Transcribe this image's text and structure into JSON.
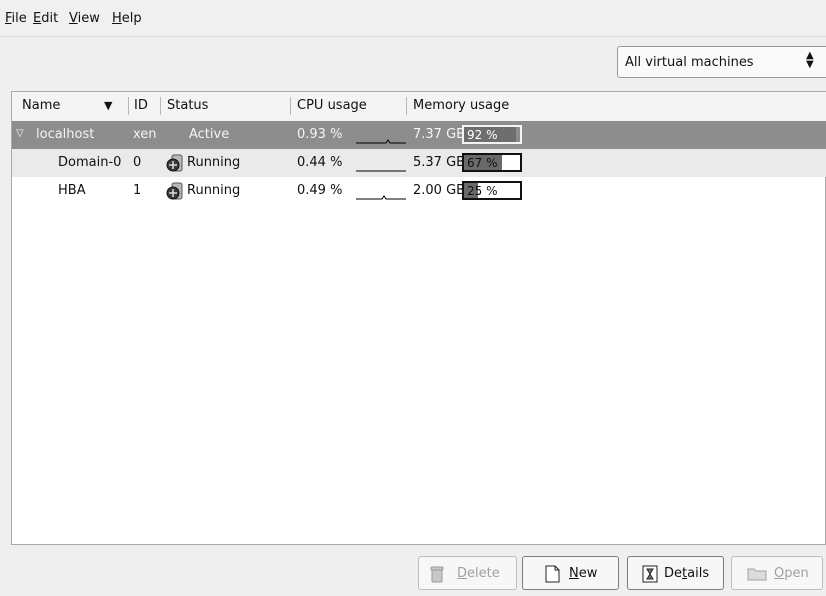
{
  "menu": {
    "file": {
      "first": "F",
      "rest": "ile"
    },
    "edit": {
      "first": "E",
      "rest": "dit"
    },
    "view": {
      "first": "V",
      "rest": "iew"
    },
    "help": {
      "first": "H",
      "rest": "elp"
    }
  },
  "filter": {
    "selected": "All virtual machines"
  },
  "columns": {
    "name": "Name",
    "id": "ID",
    "status": "Status",
    "cpu": "CPU usage",
    "memory": "Memory usage"
  },
  "rows": [
    {
      "name": "localhost",
      "id": "xen",
      "status": "Active",
      "cpu": "0.93 %",
      "mem": "7.37 GB",
      "mem_pct_label": "92 %",
      "mem_fraction": 0.92
    },
    {
      "name": "Domain-0",
      "id": "0",
      "status": "Running",
      "cpu": "0.44 %",
      "mem": "5.37 GB",
      "mem_pct_label": "67 %",
      "mem_fraction": 0.67
    },
    {
      "name": "HBA",
      "id": "1",
      "status": "Running",
      "cpu": "0.49 %",
      "mem": "2.00 GB",
      "mem_pct_label": "25 %",
      "mem_fraction": 0.25
    }
  ],
  "buttons": {
    "delete": {
      "first": "D",
      "rest": "elete"
    },
    "new": {
      "first": "N",
      "rest": "ew"
    },
    "details": {
      "pre": "De",
      "mid": "t",
      "post": "ails"
    },
    "open": {
      "first": "O",
      "rest": "pen"
    }
  },
  "icons": {
    "row_status": "vm-status-icon",
    "delete": "trash-icon",
    "new": "new-document-icon",
    "details": "details-icon",
    "open": "folder-icon"
  }
}
